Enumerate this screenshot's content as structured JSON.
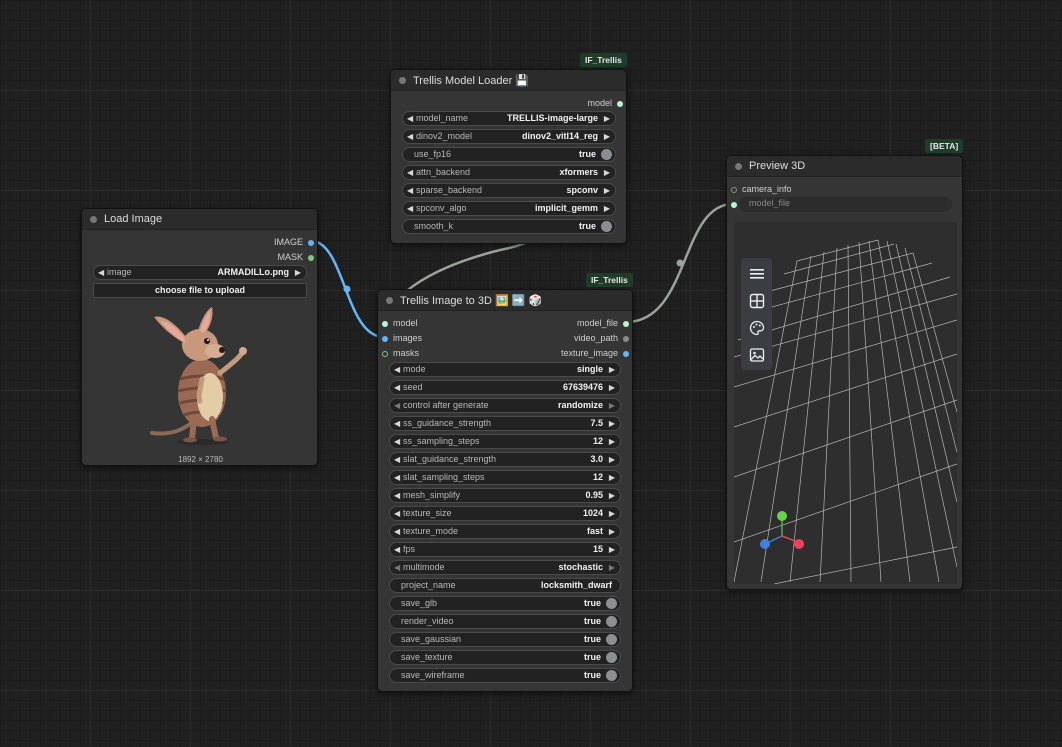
{
  "colors": {
    "image_link": "#64b5f6",
    "model_link": "#a0a8a0",
    "slot_image": "#64b5f6",
    "slot_mask": "#81c784",
    "slot_model": "#b9f6ca",
    "badge_bg": "#1f3b2a"
  },
  "load_image": {
    "title": "Load Image",
    "outputs": [
      "IMAGE",
      "MASK"
    ],
    "image_widget": {
      "label": "image",
      "value": "ARMADILLo.png"
    },
    "upload_button": "choose file to upload",
    "preview_size": "1892 × 2780"
  },
  "model_loader": {
    "badge": "IF_Trellis",
    "title": "Trellis Model Loader 💾",
    "output": "model",
    "widgets": [
      {
        "label": "model_name",
        "value": "TRELLIS-image-large",
        "kind": "combo"
      },
      {
        "label": "dinov2_model",
        "value": "dinov2_vitl14_reg",
        "kind": "combo"
      },
      {
        "label": "use_fp16",
        "value": "true",
        "kind": "toggle"
      },
      {
        "label": "attn_backend",
        "value": "xformers",
        "kind": "combo"
      },
      {
        "label": "sparse_backend",
        "value": "spconv",
        "kind": "combo"
      },
      {
        "label": "spconv_algo",
        "value": "implicit_gemm",
        "kind": "combo"
      },
      {
        "label": "smooth_k",
        "value": "true",
        "kind": "toggle"
      }
    ]
  },
  "image_to_3d": {
    "badge": "IF_Trellis",
    "title": "Trellis Image to 3D 🖼️ ➡️ 🎲",
    "inputs": [
      "model",
      "images",
      "masks"
    ],
    "outputs": [
      "model_file",
      "video_path",
      "texture_image"
    ],
    "widgets": [
      {
        "label": "mode",
        "value": "single",
        "kind": "combo"
      },
      {
        "label": "seed",
        "value": "67639476",
        "kind": "number"
      },
      {
        "label": "control after generate",
        "value": "randomize",
        "kind": "combo"
      },
      {
        "label": "ss_guidance_strength",
        "value": "7.5",
        "kind": "number"
      },
      {
        "label": "ss_sampling_steps",
        "value": "12",
        "kind": "number"
      },
      {
        "label": "slat_guidance_strength",
        "value": "3.0",
        "kind": "number"
      },
      {
        "label": "slat_sampling_steps",
        "value": "12",
        "kind": "number"
      },
      {
        "label": "mesh_simplify",
        "value": "0.95",
        "kind": "number"
      },
      {
        "label": "texture_size",
        "value": "1024",
        "kind": "number"
      },
      {
        "label": "texture_mode",
        "value": "fast",
        "kind": "combo"
      },
      {
        "label": "fps",
        "value": "15",
        "kind": "number"
      },
      {
        "label": "multimode",
        "value": "stochastic",
        "kind": "combo"
      },
      {
        "label": "project_name",
        "value": "locksmith_dwarf",
        "kind": "text"
      },
      {
        "label": "save_glb",
        "value": "true",
        "kind": "toggle"
      },
      {
        "label": "render_video",
        "value": "true",
        "kind": "toggle"
      },
      {
        "label": "save_gaussian",
        "value": "true",
        "kind": "toggle"
      },
      {
        "label": "save_texture",
        "value": "true",
        "kind": "toggle"
      },
      {
        "label": "save_wireframe",
        "value": "true",
        "kind": "toggle"
      }
    ]
  },
  "preview_3d": {
    "badge": "[BETA]",
    "title": "Preview 3D",
    "inputs": [
      "camera_info",
      "model_file"
    ],
    "toolbar_icons": [
      "menu-icon",
      "layout-icon",
      "palette-icon",
      "image-icon"
    ]
  }
}
